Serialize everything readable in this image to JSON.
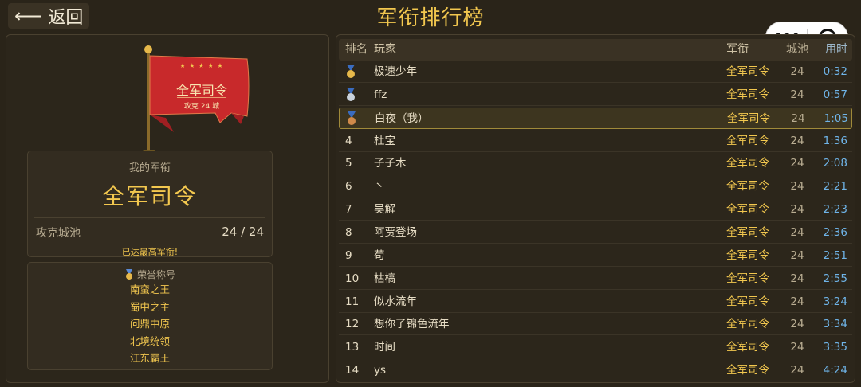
{
  "header": {
    "back_label": "返回",
    "title": "军衔排行榜"
  },
  "flag": {
    "stars": "★ ★ ★ ★ ★",
    "rank": "全军司令",
    "sub": "攻克 24 城"
  },
  "my_rank": {
    "label": "我的军衔",
    "rank": "全军司令",
    "cities_label": "攻克城池",
    "cities_value": "24 / 24",
    "note": "已达最高军衔!"
  },
  "honors": {
    "heading": "荣誉称号",
    "items": [
      "南蛮之王",
      "蜀中之主",
      "问鼎中原",
      "北境统领",
      "江东霸王"
    ]
  },
  "table": {
    "columns": {
      "rank": "排名",
      "player": "玩家",
      "title": "军衔",
      "cities": "城池",
      "time": "用时"
    },
    "rows": [
      {
        "rank": "",
        "medal": "gold",
        "name": "极速少年",
        "title": "全军司令",
        "cities": "24",
        "time": "0:32"
      },
      {
        "rank": "",
        "medal": "silver",
        "name": "ffz",
        "title": "全军司令",
        "cities": "24",
        "time": "0:57"
      },
      {
        "rank": "",
        "medal": "bronze",
        "name": "白夜（我）",
        "title": "全军司令",
        "cities": "24",
        "time": "1:05",
        "me": true
      },
      {
        "rank": "4",
        "name": "杜宝",
        "title": "全军司令",
        "cities": "24",
        "time": "1:36"
      },
      {
        "rank": "5",
        "name": "子子木",
        "title": "全军司令",
        "cities": "24",
        "time": "2:08"
      },
      {
        "rank": "6",
        "name": "丶",
        "title": "全军司令",
        "cities": "24",
        "time": "2:21"
      },
      {
        "rank": "7",
        "name": "吴解",
        "title": "全军司令",
        "cities": "24",
        "time": "2:23"
      },
      {
        "rank": "8",
        "name": "阿贾登场",
        "title": "全军司令",
        "cities": "24",
        "time": "2:36"
      },
      {
        "rank": "9",
        "name": "苟",
        "title": "全军司令",
        "cities": "24",
        "time": "2:51"
      },
      {
        "rank": "10",
        "name": "枯槁",
        "title": "全军司令",
        "cities": "24",
        "time": "2:55"
      },
      {
        "rank": "11",
        "name": "似水流年",
        "title": "全军司令",
        "cities": "24",
        "time": "3:24"
      },
      {
        "rank": "12",
        "name": "想你了锦色流年",
        "title": "全军司令",
        "cities": "24",
        "time": "3:34"
      },
      {
        "rank": "13",
        "name": "时间",
        "title": "全军司令",
        "cities": "24",
        "time": "3:35"
      },
      {
        "rank": "14",
        "name": "ys",
        "title": "全军司令",
        "cities": "24",
        "time": "4:24"
      }
    ]
  },
  "colors": {
    "accent": "#f3c84f",
    "time": "#6fb4e8",
    "background": "#2a2419",
    "flag": "#c8292b"
  }
}
